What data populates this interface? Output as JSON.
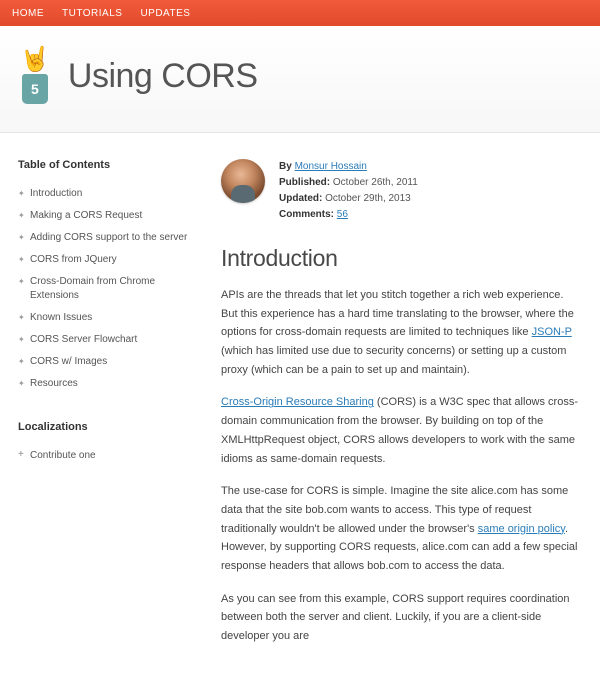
{
  "nav": {
    "items": [
      "HOME",
      "TUTORIALS",
      "UPDATES"
    ]
  },
  "header": {
    "title": "Using CORS",
    "badge": "5"
  },
  "toc": {
    "heading": "Table of Contents",
    "items": [
      "Introduction",
      "Making a CORS Request",
      "Adding CORS support to the server",
      "CORS from JQuery",
      "Cross-Domain from Chrome Extensions",
      "Known Issues",
      "CORS Server Flowchart",
      "CORS w/ Images",
      "Resources"
    ]
  },
  "loc": {
    "heading": "Localizations",
    "items": [
      "Contribute one"
    ]
  },
  "byline": {
    "by_label": "By",
    "author": "Monsur Hossain",
    "pub_label": "Published:",
    "pub_date": "October 26th, 2011",
    "upd_label": "Updated:",
    "upd_date": "October 29th, 2013",
    "com_label": "Comments:",
    "com_count": "56"
  },
  "intro": {
    "heading": "Introduction",
    "p1a": "APIs are the threads that let you stitch together a rich web experience. But this experience has a hard time translating to the browser, where the options for cross-domain requests are limited to techniques like ",
    "p1_link1": "JSON-P",
    "p1b": " (which has limited use due to security concerns) or setting up a custom proxy (which can be a pain to set up and maintain).",
    "p2_link1": "Cross-Origin Resource Sharing",
    "p2a": " (CORS) is a W3C spec that allows cross-domain communication from the browser. By building on top of the XMLHttpRequest object, CORS allows developers to work with the same idioms as same-domain requests.",
    "p3a": "The use-case for CORS is simple. Imagine the site alice.com has some data that the site bob.com wants to access. This type of request traditionally wouldn't be allowed under the browser's ",
    "p3_link1": "same origin policy",
    "p3b": ". However, by supporting CORS requests, alice.com can add a few special response headers that allows bob.com to access the data.",
    "p4": "As you can see from this example, CORS support requires coordination between both the server and client. Luckily, if you are a client-side developer you are"
  }
}
